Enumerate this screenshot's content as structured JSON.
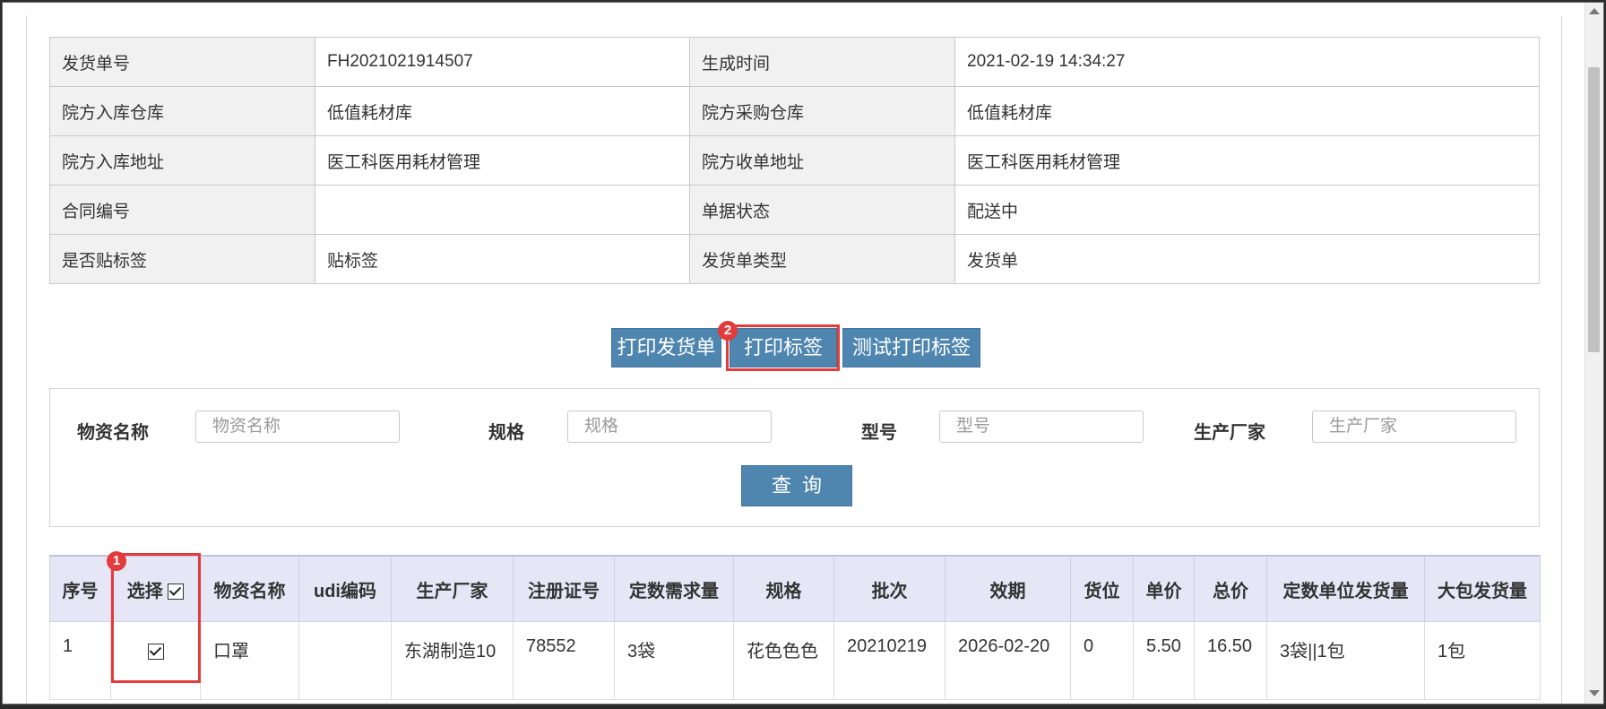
{
  "info": [
    [
      {
        "label": "发货单号",
        "value": "FH2021021914507"
      },
      {
        "label": "生成时间",
        "value": "2021-02-19 14:34:27"
      }
    ],
    [
      {
        "label": "院方入库仓库",
        "value": "低值耗材库"
      },
      {
        "label": "院方采购仓库",
        "value": "低值耗材库"
      }
    ],
    [
      {
        "label": "院方入库地址",
        "value": "医工科医用耗材管理"
      },
      {
        "label": "院方收单地址",
        "value": "医工科医用耗材管理"
      }
    ],
    [
      {
        "label": "合同编号",
        "value": ""
      },
      {
        "label": "单据状态",
        "value": "配送中"
      }
    ],
    [
      {
        "label": "是否贴标签",
        "value": "贴标签"
      },
      {
        "label": "发货单类型",
        "value": "发货单"
      }
    ]
  ],
  "actions": {
    "print_slip": "打印发货单",
    "print_label": "打印标签",
    "test_print_label": "测试打印标签"
  },
  "badges": {
    "select": "1",
    "print_label": "2"
  },
  "search": {
    "name_label": "物资名称",
    "name_placeholder": "物资名称",
    "spec_label": "规格",
    "spec_placeholder": "规格",
    "model_label": "型号",
    "model_placeholder": "型号",
    "maker_label": "生产厂家",
    "maker_placeholder": "生产厂家",
    "query_button": "查询"
  },
  "items": {
    "columns": [
      "序号",
      "选择",
      "物资名称",
      "udi编码",
      "生产厂家",
      "注册证号",
      "定数需求量",
      "规格",
      "批次",
      "效期",
      "货位",
      "单价",
      "总价",
      "定数单位发货量",
      "大包发货量"
    ],
    "rows": [
      {
        "no": "1",
        "selected": true,
        "name": "口罩",
        "udi": "",
        "maker": "东湖制造10",
        "reg_no": "78552",
        "demand": "3袋",
        "spec": "花色色色",
        "batch": "20210219",
        "expiry": "2026-02-20",
        "location": "0",
        "unit_price": "5.50",
        "total": "16.50",
        "unit_ship": "3袋||1包",
        "pack_ship": "1包"
      }
    ]
  },
  "colors": {
    "accent": "#4f86b0",
    "highlight": "#e23b3b",
    "header_bg": "#e6e6f7"
  }
}
